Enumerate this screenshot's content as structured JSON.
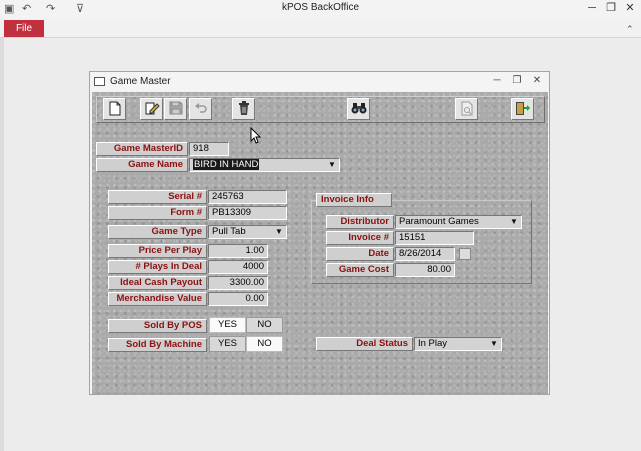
{
  "app": {
    "title": "kPOS BackOffice",
    "file_tab": "File"
  },
  "form": {
    "title": "Game Master",
    "game_master_id": {
      "label": "Game MasterID",
      "value": "918"
    },
    "game_name": {
      "label": "Game  Name",
      "value": "BIRD IN HAND"
    },
    "serial": {
      "label": "Serial #",
      "value": "245763"
    },
    "form_no": {
      "label": "Form #",
      "value": "PB13309"
    },
    "game_type": {
      "label": "Game Type",
      "value": "Pull Tab"
    },
    "price_per_play": {
      "label": "Price Per Play",
      "value": "1.00"
    },
    "plays_in_deal": {
      "label": "# Plays In Deal",
      "value": "4000"
    },
    "ideal_cash_payout": {
      "label": "Ideal Cash Payout",
      "value": "3300.00"
    },
    "merchandise_value": {
      "label": "Merchandise Value",
      "value": "0.00"
    },
    "sold_by_pos": {
      "label": "Sold By POS",
      "yes": "YES",
      "no": "NO",
      "selected": "YES"
    },
    "sold_by_machine": {
      "label": "Sold By Machine",
      "yes": "YES",
      "no": "NO",
      "selected": "NO"
    },
    "invoice": {
      "title": "Invoice Info",
      "distributor": {
        "label": "Distributor",
        "value": "Paramount Games"
      },
      "invoice_no": {
        "label": "Invoice #",
        "value": "15151"
      },
      "date": {
        "label": "Date",
        "value": "8/26/2014"
      },
      "game_cost": {
        "label": "Game Cost",
        "value": "80.00"
      }
    },
    "deal_status": {
      "label": "Deal Status",
      "value": "In Play"
    }
  },
  "toolbar_icons": [
    "new-record-icon",
    "edit-record-icon",
    "save-icon",
    "undo-icon",
    "delete-icon",
    "find-binoculars-icon",
    "print-preview-icon",
    "exit-icon"
  ]
}
